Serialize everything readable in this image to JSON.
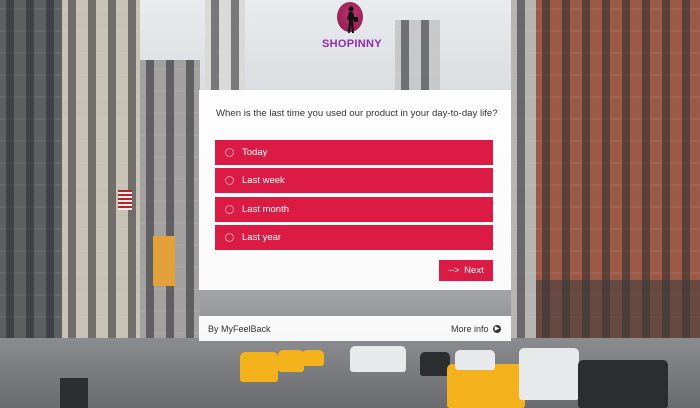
{
  "brand": {
    "logo_text": "SHOPINNY"
  },
  "survey": {
    "question": "When is the last time you used our product in your day-to-day life?",
    "options": [
      {
        "label": "Today"
      },
      {
        "label": "Last week"
      },
      {
        "label": "Last month"
      },
      {
        "label": "Last year"
      }
    ],
    "next_label": "Next",
    "next_arrow": "-->"
  },
  "footer": {
    "credit": "By MyFeelBack",
    "more_label": "More info"
  },
  "colors": {
    "accent": "#db1b43",
    "logo": "#8e2bb0"
  }
}
